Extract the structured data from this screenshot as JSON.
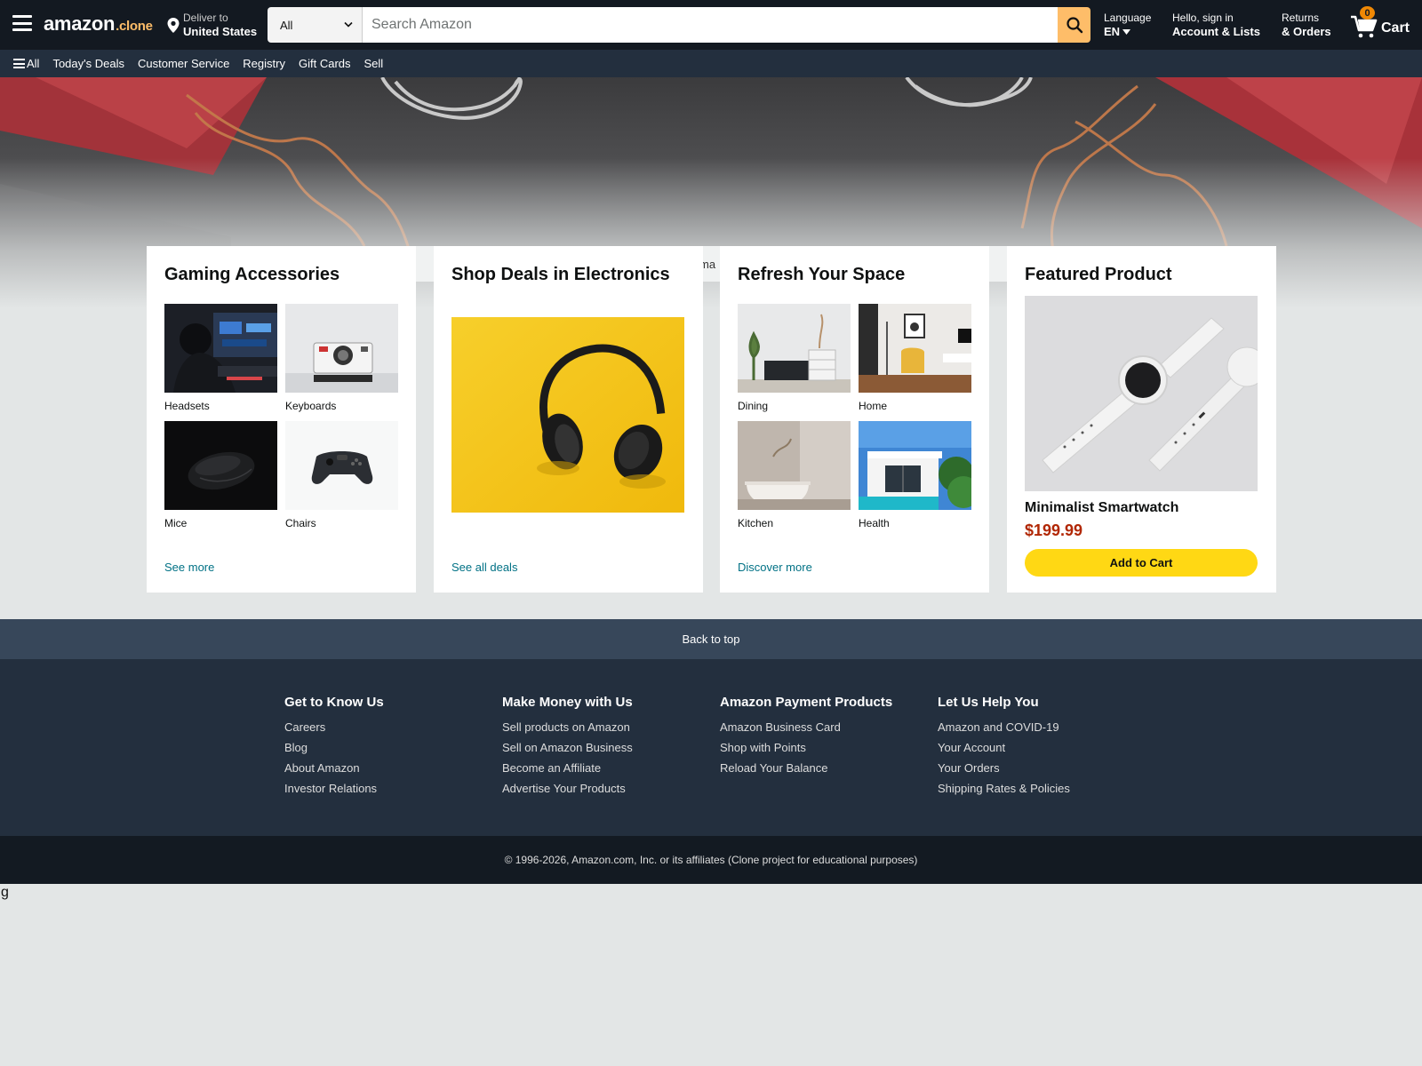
{
  "header": {
    "logo_main": "amazon",
    "logo_suffix": ".clone",
    "deliver_line1": "Deliver to",
    "deliver_line2": "United States",
    "search_category": "All",
    "search_placeholder": "Search Amazon",
    "language_line1": "Language",
    "language_line2": "EN",
    "account_line1": "Hello, sign in",
    "account_line2": "Account & Lists",
    "returns_line1": "Returns",
    "returns_line2": "& Orders",
    "cart_count": "0",
    "cart_label": "Cart"
  },
  "subnav": {
    "all": "All",
    "items": [
      "Today's Deals",
      "Customer Service",
      "Registry",
      "Gift Cards",
      "Sell"
    ]
  },
  "hero": {
    "strip_text": "ma"
  },
  "cards": {
    "gaming": {
      "title": "Gaming Accessories",
      "tiles": [
        "Headsets",
        "Keyboards",
        "Mice",
        "Chairs"
      ],
      "link": "See more"
    },
    "electronics": {
      "title": "Shop Deals in Electronics",
      "link": "See all deals"
    },
    "space": {
      "title": "Refresh Your Space",
      "tiles": [
        "Dining",
        "Home",
        "Kitchen",
        "Health"
      ],
      "link": "Discover more"
    },
    "featured": {
      "title": "Featured Product",
      "name": "Minimalist Smartwatch",
      "price": "$199.99",
      "button": "Add to Cart"
    }
  },
  "footer": {
    "back_to_top": "Back to top",
    "columns": [
      {
        "title": "Get to Know Us",
        "links": [
          "Careers",
          "Blog",
          "About Amazon",
          "Investor Relations"
        ]
      },
      {
        "title": "Make Money with Us",
        "links": [
          "Sell products on Amazon",
          "Sell on Amazon Business",
          "Become an Affiliate",
          "Advertise Your Products"
        ]
      },
      {
        "title": "Amazon Payment Products",
        "links": [
          "Amazon Business Card",
          "Shop with Points",
          "Reload Your Balance"
        ]
      },
      {
        "title": "Let Us Help You",
        "links": [
          "Amazon and COVID-19",
          "Your Account",
          "Your Orders",
          "Shipping Rates & Policies"
        ]
      }
    ],
    "copyright": "© 1996-2026, Amazon.com, Inc. or its affiliates (Clone project for educational purposes)"
  },
  "stray_text": "g",
  "colors": {
    "nav_dark": "#131921",
    "nav_sub": "#232f3e",
    "search_button": "#febd69",
    "link": "#007185",
    "price": "#b12704",
    "cart_button": "#ffd814"
  },
  "icons": [
    "hamburger-icon",
    "location-pin-icon",
    "chevron-down-icon",
    "search-icon",
    "cart-icon"
  ]
}
